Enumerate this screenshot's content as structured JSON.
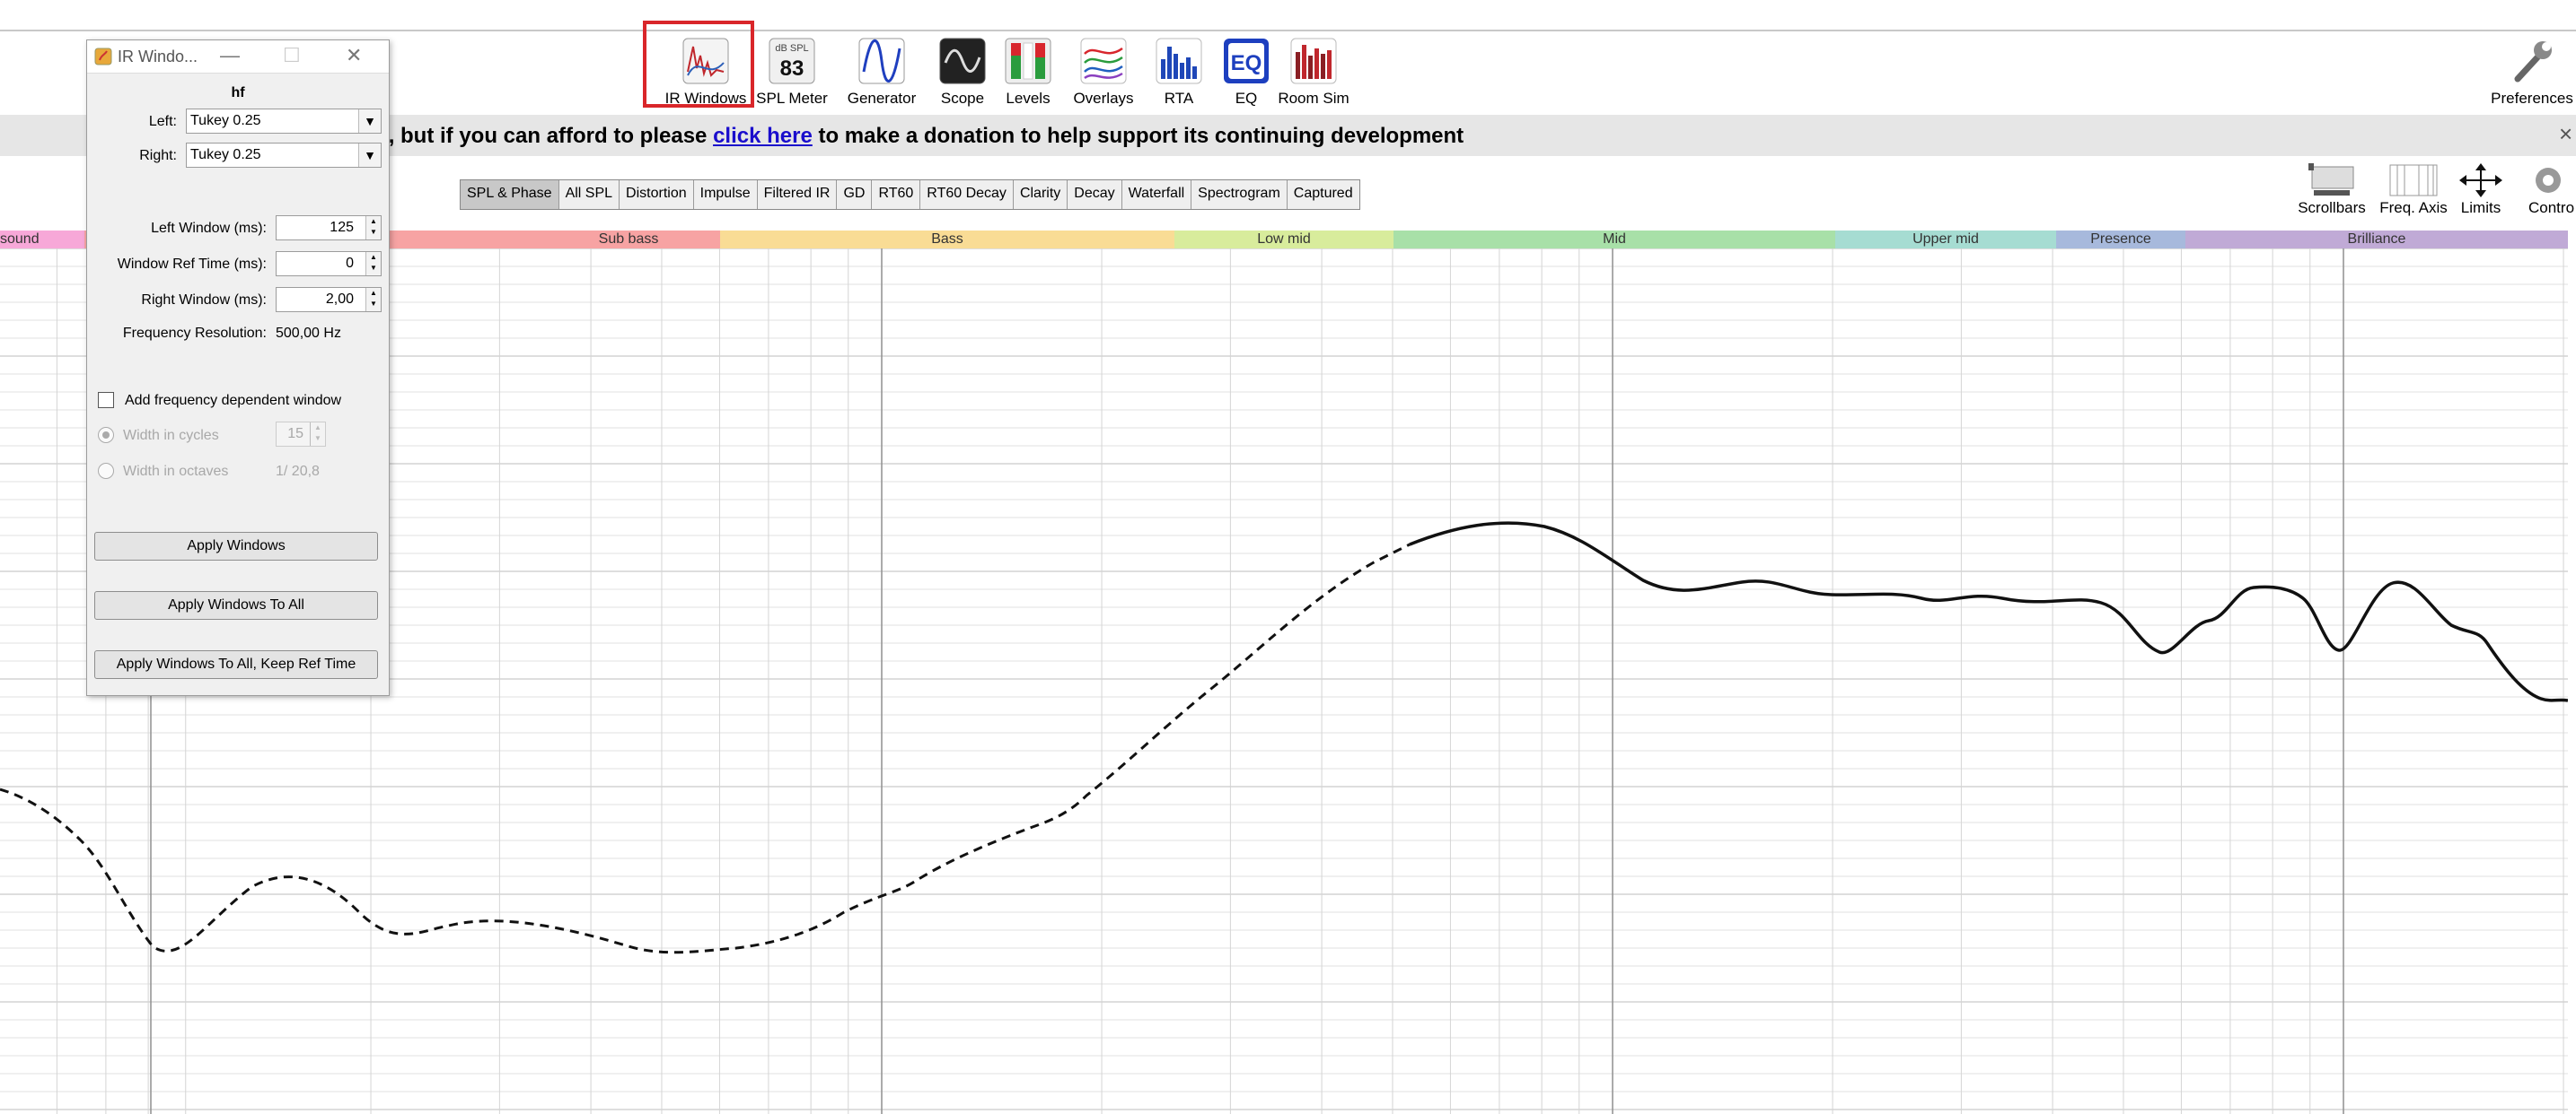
{
  "toolbar": {
    "items": [
      {
        "label": "IR Windows"
      },
      {
        "label": "SPL Meter",
        "icon_text_top": "dB SPL",
        "icon_text_value": "83"
      },
      {
        "label": "Generator"
      },
      {
        "label": "Scope"
      },
      {
        "label": "Levels"
      },
      {
        "label": "Overlays"
      },
      {
        "label": "RTA"
      },
      {
        "label": "EQ",
        "icon_text": "EQ"
      },
      {
        "label": "Room Sim"
      }
    ],
    "preferences_label": "Preferences",
    "highlight_color": "#d9262a"
  },
  "banner": {
    "text_before": "re, but if you can afford to please ",
    "link_text": "click here",
    "text_after": " to make a donation to help support its continuing development",
    "close_symbol": "×"
  },
  "graph_tabs": [
    {
      "label": "SPL & Phase",
      "active": true
    },
    {
      "label": "All SPL",
      "active": false
    },
    {
      "label": "Distortion",
      "active": false
    },
    {
      "label": "Impulse",
      "active": false
    },
    {
      "label": "Filtered IR",
      "active": false
    },
    {
      "label": "GD",
      "active": false
    },
    {
      "label": "RT60",
      "active": false
    },
    {
      "label": "RT60 Decay",
      "active": false
    },
    {
      "label": "Clarity",
      "active": false
    },
    {
      "label": "Decay",
      "active": false
    },
    {
      "label": "Waterfall",
      "active": false
    },
    {
      "label": "Spectrogram",
      "active": false
    },
    {
      "label": "Captured",
      "active": false
    }
  ],
  "right_tools": {
    "scrollbars": "Scrollbars",
    "freq_axis": "Freq. Axis",
    "limits": "Limits",
    "controls": "Controls"
  },
  "bands": [
    {
      "label": "sound",
      "color": "#f7a8d8"
    },
    {
      "label": "Sub bass",
      "color": "#f7a3a3"
    },
    {
      "label": "Bass",
      "color": "#f9dc95"
    },
    {
      "label": "Low mid",
      "color": "#d8ec9c"
    },
    {
      "label": "Mid",
      "color": "#a8e0a8"
    },
    {
      "label": "Upper mid",
      "color": "#a6dcd2"
    },
    {
      "label": "Presence",
      "color": "#a7b9dc"
    },
    {
      "label": "Brilliance",
      "color": "#c0aad6"
    }
  ],
  "dialog": {
    "title": "IR Windo...",
    "measurement_name": "hf",
    "left_label": "Left:",
    "left_value": "Tukey 0.25",
    "right_label": "Right:",
    "right_value": "Tukey 0.25",
    "left_window_label": "Left Window (ms):",
    "left_window_value": "125",
    "ref_time_label": "Window Ref Time (ms):",
    "ref_time_value": "0",
    "right_window_label": "Right Window (ms):",
    "right_window_value": "2,00",
    "freq_res_label": "Frequency Resolution:",
    "freq_res_value": "500,00 Hz",
    "add_fdw_label": "Add frequency dependent window",
    "add_fdw_checked": false,
    "width_cycles_label": "Width in cycles",
    "width_cycles_value": "15",
    "width_octaves_label": "Width in octaves",
    "width_octaves_value": "1/ 20,8",
    "apply_windows": "Apply Windows",
    "apply_windows_all": "Apply Windows To All",
    "apply_windows_all_keep": "Apply Windows To All, Keep Ref Time"
  }
}
